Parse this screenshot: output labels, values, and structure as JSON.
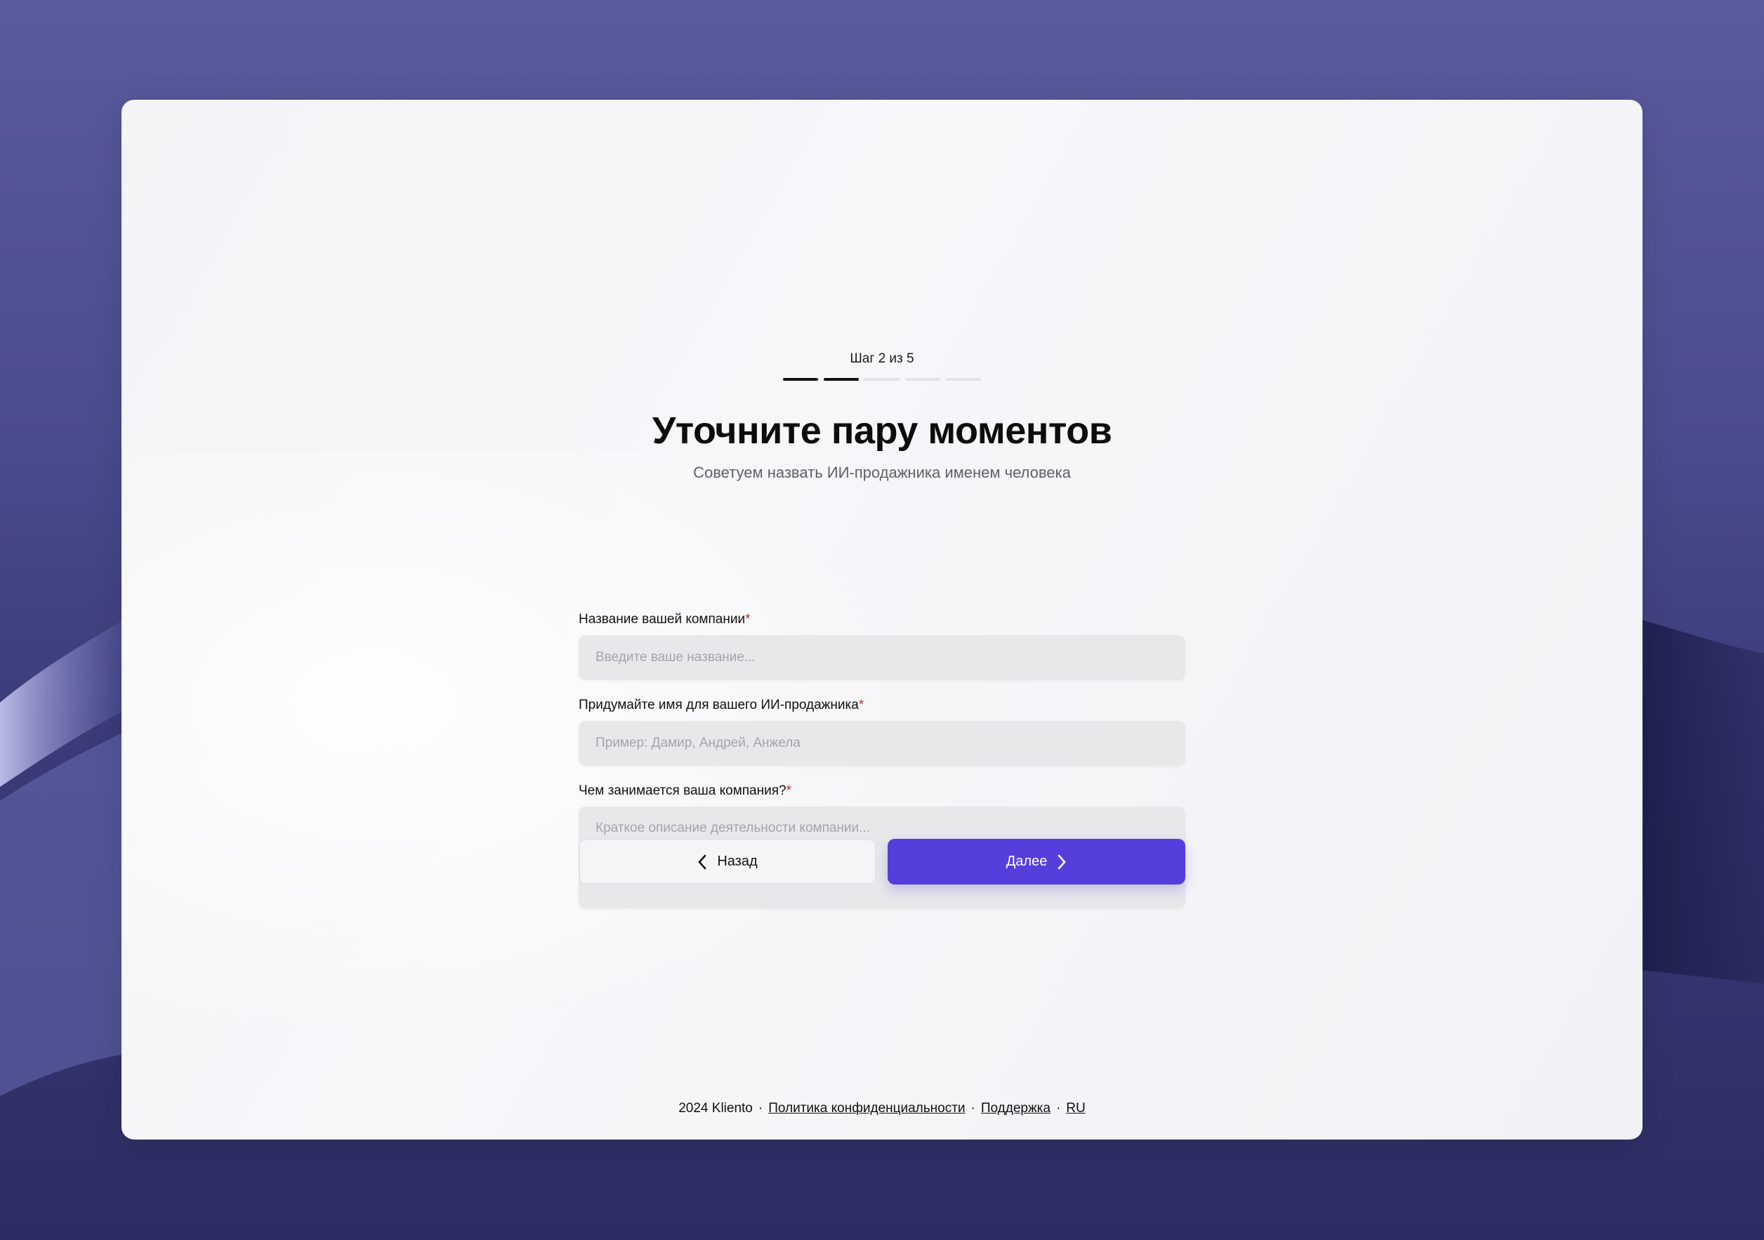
{
  "progress": {
    "step_label": "Шаг 2 из 5",
    "current_step": 2,
    "total_steps": 5
  },
  "header": {
    "title": "Уточните пару моментов",
    "subtitle": "Советуем назвать ИИ-продажника именем человека"
  },
  "form": {
    "company_name": {
      "label": "Название вашей компании",
      "required_mark": "*",
      "placeholder": "Введите ваше название...",
      "value": ""
    },
    "agent_name": {
      "label": "Придумайте имя для вашего ИИ-продажника",
      "required_mark": "*",
      "placeholder": "Пример: Дамир, Андрей, Анжела",
      "value": ""
    },
    "company_activity": {
      "label": "Чем занимается ваша компания?",
      "required_mark": "*",
      "placeholder": "Краткое описание деятельности компании...",
      "value": ""
    }
  },
  "buttons": {
    "back_label": "Назад",
    "back_icon": "chevron-left-icon",
    "next_label": "Далее",
    "next_icon": "chevron-right-icon"
  },
  "footer": {
    "copyright": "2024 Kliento",
    "privacy_link": "Политика конфиденциальности",
    "support_link": "Поддержка",
    "language": "RU",
    "separator": "·"
  },
  "colors": {
    "accent": "#553fdc",
    "required": "#e02424",
    "background": "#4b4c8e"
  }
}
